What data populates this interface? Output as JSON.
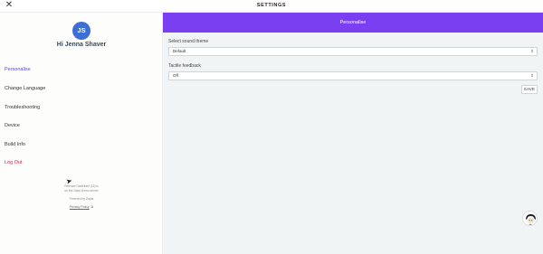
{
  "topbar": {
    "title": "SETTINGS",
    "close_glyph": "✕"
  },
  "profile": {
    "initials": "JS",
    "greeting": "Hi Jenna Shaver"
  },
  "nav": {
    "personalise": "Personalise",
    "change_language": "Change Language",
    "troubleshooting": "Troubleshooting",
    "device": "Device",
    "build_info": "Build Info",
    "log_out": "Log Out"
  },
  "footer": {
    "release_line1": "Release Castellani (13) is",
    "release_line2": "on the Saas Demo server",
    "powered_by": "Powered by Zapta",
    "privacy_policy": "Privacy Policy"
  },
  "main": {
    "header_title": "Personalise",
    "sound_theme_label": "Select sound theme",
    "sound_theme_value": "Default",
    "tactile_label": "Tactile feedback",
    "tactile_value": "Off",
    "save_label": "SAVE"
  },
  "colors": {
    "accent": "#7b3ff2",
    "active_nav": "#5b3cf0",
    "logout": "#c6284e",
    "avatar": "#3b6fd6"
  }
}
